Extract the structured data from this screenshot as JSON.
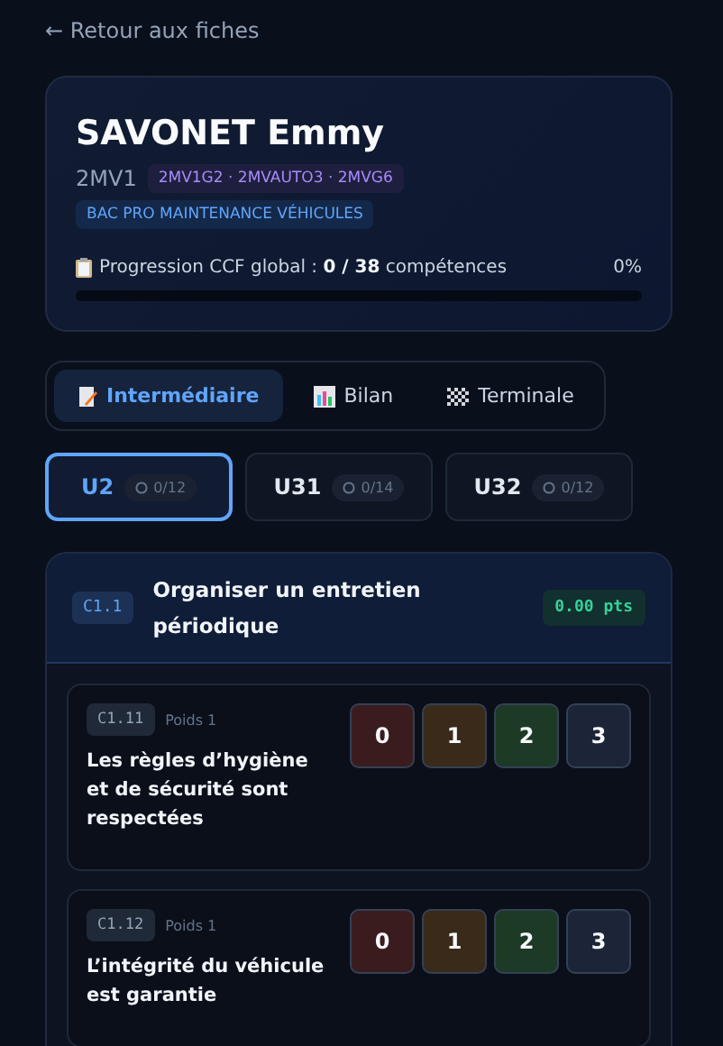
{
  "back_link": "← Retour aux fiches",
  "student": {
    "name": "SAVONET Emmy",
    "class": "2MV1",
    "groups": "2MV1G2 · 2MVAUTO3 · 2MVG6",
    "program": "BAC PRO MAINTENANCE VÉHICULES",
    "progress": {
      "label": "Progression CCF global : **0 / 38** compétences",
      "percent": "0%",
      "level": 0
    }
  },
  "tabs": [
    {
      "label": "Intermédiaire",
      "kind": "memo",
      "selected": true
    },
    {
      "label": "Bilan",
      "kind": "chart",
      "selected": false
    },
    {
      "label": "Terminale",
      "kind": "flag",
      "selected": false
    }
  ],
  "units": [
    {
      "label": "U2",
      "count": "0/12",
      "selected": true
    },
    {
      "label": "U31",
      "count": "0/14",
      "selected": false
    },
    {
      "label": "U32",
      "count": "0/12",
      "selected": false
    }
  ],
  "section": {
    "code": "C1.1",
    "title": "Organiser un entretien périodique",
    "points": "0.00 pts",
    "criteria": [
      {
        "code": "C1.11",
        "weight": "Poids 1",
        "text": "Les règles d’hygiène et de sécurité sont respectées",
        "scores": [
          {
            "label": "0",
            "color": "#3b1c1e"
          },
          {
            "label": "1",
            "color": "#3a2a1a"
          },
          {
            "label": "2",
            "color": "#1c3a26"
          },
          {
            "label": "3",
            "color": "#1c2438"
          }
        ]
      },
      {
        "code": "C1.12",
        "weight": "Poids 1",
        "text": "L’intégrité du véhicule est garantie",
        "scores": [
          {
            "label": "0",
            "color": "#3b1c1e"
          },
          {
            "label": "1",
            "color": "#3a2a1a"
          },
          {
            "label": "2",
            "color": "#1c3a26"
          },
          {
            "label": "3",
            "color": "#1c2438"
          }
        ]
      }
    ]
  }
}
